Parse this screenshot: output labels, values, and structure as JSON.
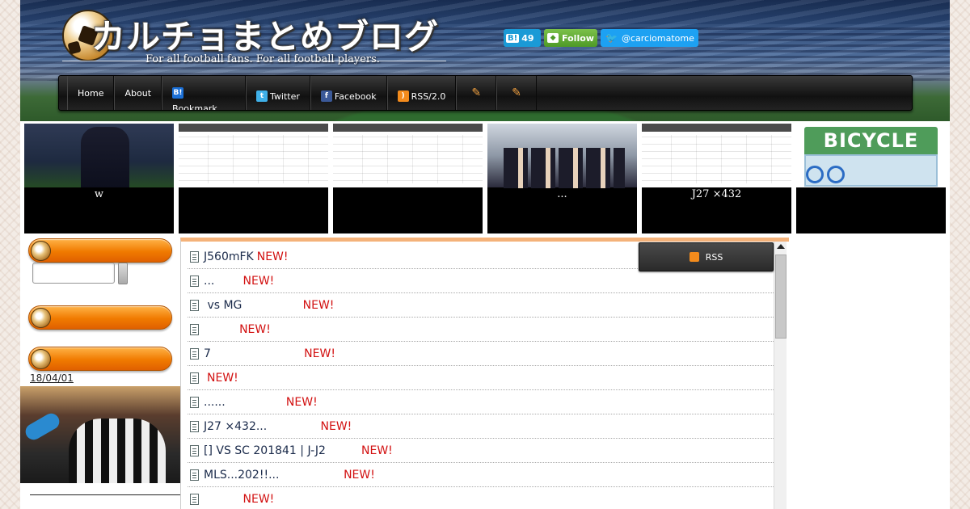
{
  "header": {
    "title": "カルチョまとめブログ",
    "subtitle": "For all football fans.  For all football players.",
    "hatena_count": "49",
    "hatena_badge": "B!",
    "follow_label": "Follow",
    "twitter_handle": "@carciomatome"
  },
  "nav": {
    "items": [
      {
        "label": "Home"
      },
      {
        "label": "About"
      },
      {
        "label": "Bookmark",
        "icon": "B!"
      },
      {
        "label": "Twitter"
      },
      {
        "label": "Facebook"
      },
      {
        "label": "RSS/2.0"
      }
    ]
  },
  "thumbnails": [
    {
      "caption": "w",
      "image": "player-photo"
    },
    {
      "caption": "",
      "image": "table-screenshot"
    },
    {
      "caption": "",
      "image": "table-screenshot"
    },
    {
      "caption": "...",
      "image": "group-photo"
    },
    {
      "caption": "J27 ×432",
      "image": "table-screenshot"
    },
    {
      "caption": "",
      "image": "bicycle-illustration",
      "sign": "BICYCLE"
    }
  ],
  "sidebar": {
    "date": "18/04/01"
  },
  "rss_button": {
    "label": "RSS"
  },
  "articles": [
    {
      "title": "J560mFK",
      "new": "NEW!"
    },
    {
      "title": "...       ",
      "new": "NEW!"
    },
    {
      "title": " vs MG                ",
      "new": "NEW!"
    },
    {
      "title": "         ",
      "new": "NEW!"
    },
    {
      "title": "7                         ",
      "new": "NEW!"
    },
    {
      "title": "",
      "new": "NEW!"
    },
    {
      "title": "......                ",
      "new": "NEW!"
    },
    {
      "title": "J27 ×432...              ",
      "new": "NEW!"
    },
    {
      "title": "[] VS SC 201841 | J-J2         ",
      "new": "NEW!"
    },
    {
      "title": "MLS...202!!...                 ",
      "new": "NEW!"
    },
    {
      "title": "          ",
      "new": "NEW!"
    }
  ]
}
